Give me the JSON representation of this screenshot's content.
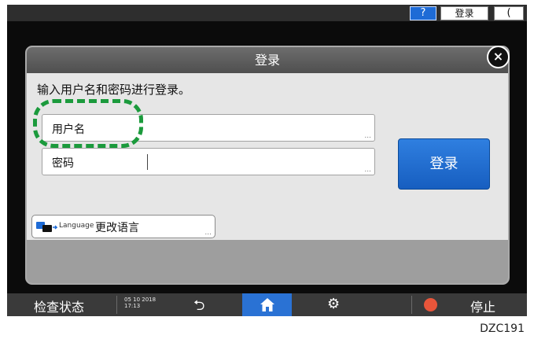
{
  "topbar": {
    "help_label": "?",
    "login_label": "登录",
    "night_mode_label": "("
  },
  "dialog": {
    "title": "登录",
    "close_label": "×",
    "instruction": "输入用户名和密码进行登录。",
    "username_label": "用户名",
    "password_label": "密码",
    "field_more": "...",
    "login_button": "登录",
    "language_word": "Language",
    "language_button": "更改语言"
  },
  "bottombar": {
    "status_label": "检查状态",
    "date": "05 10 2018",
    "time": "17:13",
    "back_label": "⮌",
    "settings_label": "⚙",
    "stop_label": "停止"
  },
  "colors": {
    "accent": "#1e6bd6",
    "highlight": "#1b9a3c",
    "stop": "#e8553a"
  },
  "figure_id": "DZC191"
}
